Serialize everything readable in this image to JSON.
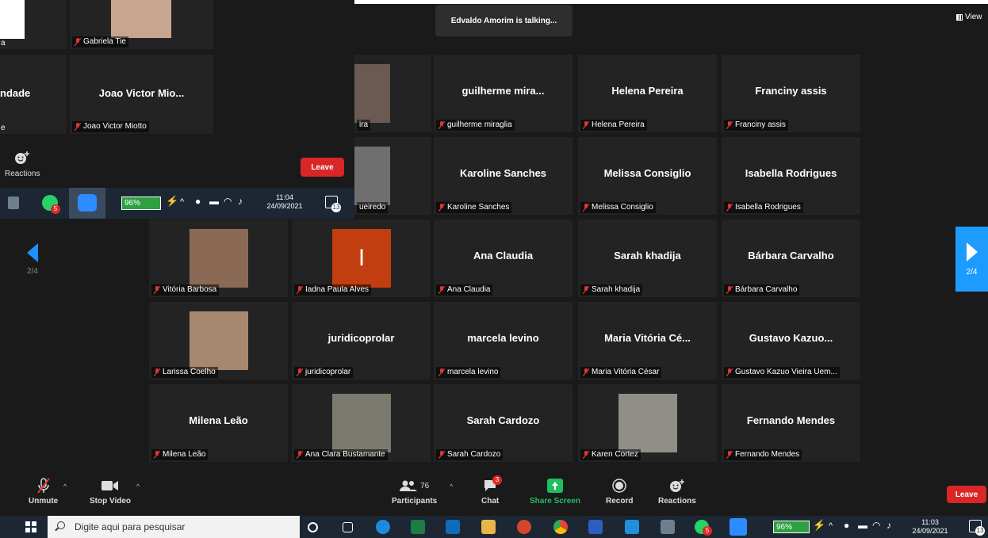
{
  "banner": {
    "talking": "Edvaldo Amorim is talking..."
  },
  "view": {
    "label": "View"
  },
  "pager": {
    "left_page": "2/4",
    "right_page": "2/4"
  },
  "tiles_bg": [
    {
      "name": "Vitória Barbosa",
      "big": "",
      "photo": "#8a6a55"
    },
    {
      "name": "Iadna Paula Alves",
      "big": "",
      "photo": "#c23e10",
      "initial": "I"
    },
    {
      "name": "Ana Claudia",
      "big": "Ana Claudia"
    },
    {
      "name": "Sarah khadija",
      "big": "Sarah khadija"
    },
    {
      "name": "Bárbara Carvalho",
      "big": "Bárbara Carvalho"
    },
    {
      "name": "Larissa Coelho",
      "big": "",
      "photo": "#a6876f"
    },
    {
      "name": "juridicoprolar",
      "big": "juridicoprolar"
    },
    {
      "name": "marcela levino",
      "big": "marcela levino"
    },
    {
      "name": "Maria Vitória César",
      "big": "Maria Vitória Cé..."
    },
    {
      "name": "Gustavo Kazuo Vieira Uem...",
      "big": "Gustavo Kazuo..."
    },
    {
      "name": "Milena Leão",
      "big": "Milena Leão"
    },
    {
      "name": "Ana Clara Bustamante",
      "big": "",
      "photo": "#7c7a6e"
    },
    {
      "name": "Sarah Cardozo",
      "big": "Sarah Cardozo"
    },
    {
      "name": "Karen Cortez",
      "big": "",
      "photo": "#8f8f88"
    },
    {
      "name": "Fernando Mendes",
      "big": "Fernando Mendes"
    },
    {
      "name": "guilherme miraglia",
      "big": "guilherme mira..."
    },
    {
      "name": "Helena Pereira",
      "big": "Helena Pereira"
    },
    {
      "name": "Franciny assis",
      "big": "Franciny assis"
    },
    {
      "name": "Karoline Sanches",
      "big": "Karoline Sanches"
    },
    {
      "name": "Melissa Consiglio",
      "big": "Melissa Consiglio"
    },
    {
      "name": "Isabella Rodrigues",
      "big": "Isabella Rodrigues"
    },
    {
      "name": "ira",
      "big": "",
      "photo": "#6b5a52"
    },
    {
      "name": "ueiredo",
      "big": "",
      "photo": "#6f6f6f"
    }
  ],
  "toolbar": {
    "unmute": "Unmute",
    "stop_video": "Stop Video",
    "participants": "Participants",
    "participants_count": "76",
    "chat": "Chat",
    "chat_badge": "3",
    "share": "Share Screen",
    "record": "Record",
    "reactions": "Reactions",
    "leave": "Leave"
  },
  "taskbar": {
    "search_placeholder": "Digite aqui para pesquisar",
    "battery": "96%",
    "time": "11:03",
    "date": "24/09/2021",
    "notif": "13",
    "whatsapp_badge": "5"
  },
  "overlay": {
    "gabriela": "Gabriela Tie",
    "joao_big": "Joao Victor Mio...",
    "joao_label": "Joao Victor Miotto",
    "left_partial_big": "ndade",
    "left_partial_label_a": "a",
    "left_partial_label_b": "e",
    "reactions": "Reactions",
    "leave": "Leave",
    "battery": "96%",
    "time": "11:04",
    "date": "24/09/2021",
    "notif": "13",
    "whatsapp_badge": "5"
  },
  "colors": {
    "accent": "#1e9bff",
    "leave": "#d92626",
    "share": "#1fbf5f",
    "tile": "#232323",
    "background": "#1a1a1a"
  }
}
